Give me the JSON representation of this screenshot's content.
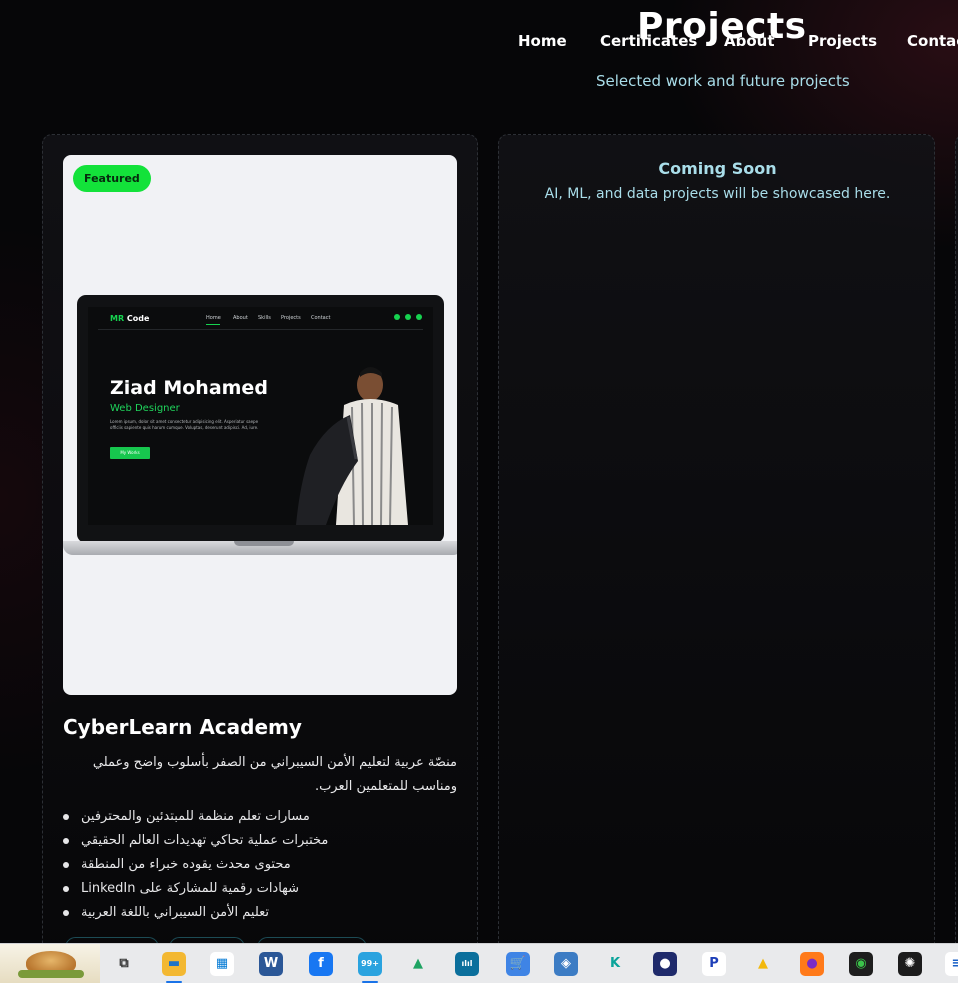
{
  "nav": {
    "items": [
      {
        "label": "Home"
      },
      {
        "label": "Certificates"
      },
      {
        "label": "About"
      },
      {
        "label": "Projects"
      },
      {
        "label": "Contac"
      }
    ]
  },
  "section": {
    "title": "Projects",
    "subtitle": "Selected work and future projects"
  },
  "projects": [
    {
      "badge": "Featured",
      "title": "CyberLearn Academy",
      "description": "منصّة عربية لتعليم الأمن السيبراني من الصفر بأسلوب واضح وعملي ومناسب للمتعلمين العرب.",
      "features": [
        "مسارات تعلم منظمة للمبتدئين والمحترفين",
        "مختبرات عملية تحاكي تهديدات العالم الحقيقي",
        "محتوى محدث يقوده خبراء من المنطقة",
        "شهادات رقمية للمشاركة على LinkedIn",
        "تعليم الأمن السيبراني باللغة العربية"
      ],
      "mockup": {
        "logo_primary": "MR",
        "logo_secondary": "Code",
        "nav": [
          "Home",
          "About",
          "Skills",
          "Projects",
          "Contact"
        ],
        "name": "Ziad Mohamed",
        "role": "Web Designer",
        "lorem": "Lorem ipsum, dolor sit amet consectetur adipisicing elit. Asperiatur saepe officiis sapiente quis harum cumque. Voluptas, deserunt adipisci. Ad, iure.",
        "button": "My Works"
      }
    },
    {
      "title": "Coming Soon",
      "description": "AI, ML, and data projects will be showcased here."
    }
  ],
  "taskbar": {
    "icons": [
      {
        "name": "task-view-icon",
        "glyph": "⧉",
        "color": "#e9eaec",
        "fg": "#333"
      },
      {
        "name": "file-explorer-icon",
        "glyph": "▬",
        "color": "#f3b832",
        "fg": "#1e73c7"
      },
      {
        "name": "microsoft-store-icon",
        "glyph": "▦",
        "color": "#ffffff",
        "fg": "#0078d4"
      },
      {
        "name": "word-icon",
        "glyph": "W",
        "color": "#2b5797",
        "fg": "#ffffff"
      },
      {
        "name": "facebook-icon",
        "glyph": "f",
        "color": "#1877f2",
        "fg": "#ffffff"
      },
      {
        "name": "telegram-icon",
        "glyph": "99+",
        "color": "#2aa3df",
        "fg": "#ffffff"
      },
      {
        "name": "google-drive-icon",
        "glyph": "▲",
        "color": "#e9eaec",
        "fg": "#1ea362"
      },
      {
        "name": "cisco-packet-tracer-icon",
        "glyph": "ılıl",
        "color": "#0b6f9c",
        "fg": "#ffffff"
      },
      {
        "name": "shopping-cart-icon",
        "glyph": "🛒",
        "color": "#3f84e5",
        "fg": "#ffffff"
      },
      {
        "name": "shield-app-icon",
        "glyph": "◈",
        "color": "#3c7cc4",
        "fg": "#ffffff"
      },
      {
        "name": "k-app-icon",
        "glyph": "K",
        "color": "#e9eaec",
        "fg": "#0aa39a"
      },
      {
        "name": "tradestop-icon",
        "glyph": "●",
        "color": "#1f2a6b",
        "fg": "#ffffff"
      },
      {
        "name": "p-app-icon",
        "glyph": "P",
        "color": "#ffffff",
        "fg": "#1d3fb8"
      },
      {
        "name": "google-drive-2-icon",
        "glyph": "▲",
        "color": "#e9eaec",
        "fg": "#f2b80d"
      },
      {
        "name": "firefox-icon",
        "glyph": "●",
        "color": "#ff7a1a",
        "fg": "#7a2cc6"
      },
      {
        "name": "obs-icon",
        "glyph": "◉",
        "color": "#1e1e1e",
        "fg": "#3bc24a"
      },
      {
        "name": "chatgpt-icon",
        "glyph": "✺",
        "color": "#1c1c1c",
        "fg": "#ffffff"
      },
      {
        "name": "ide-icon",
        "glyph": "≡",
        "color": "#ffffff",
        "fg": "#1b62c7"
      }
    ]
  },
  "colors": {
    "accent_cyan": "#a9dde9",
    "badge_green": "#13e23a",
    "mockup_green": "#16d24f"
  }
}
